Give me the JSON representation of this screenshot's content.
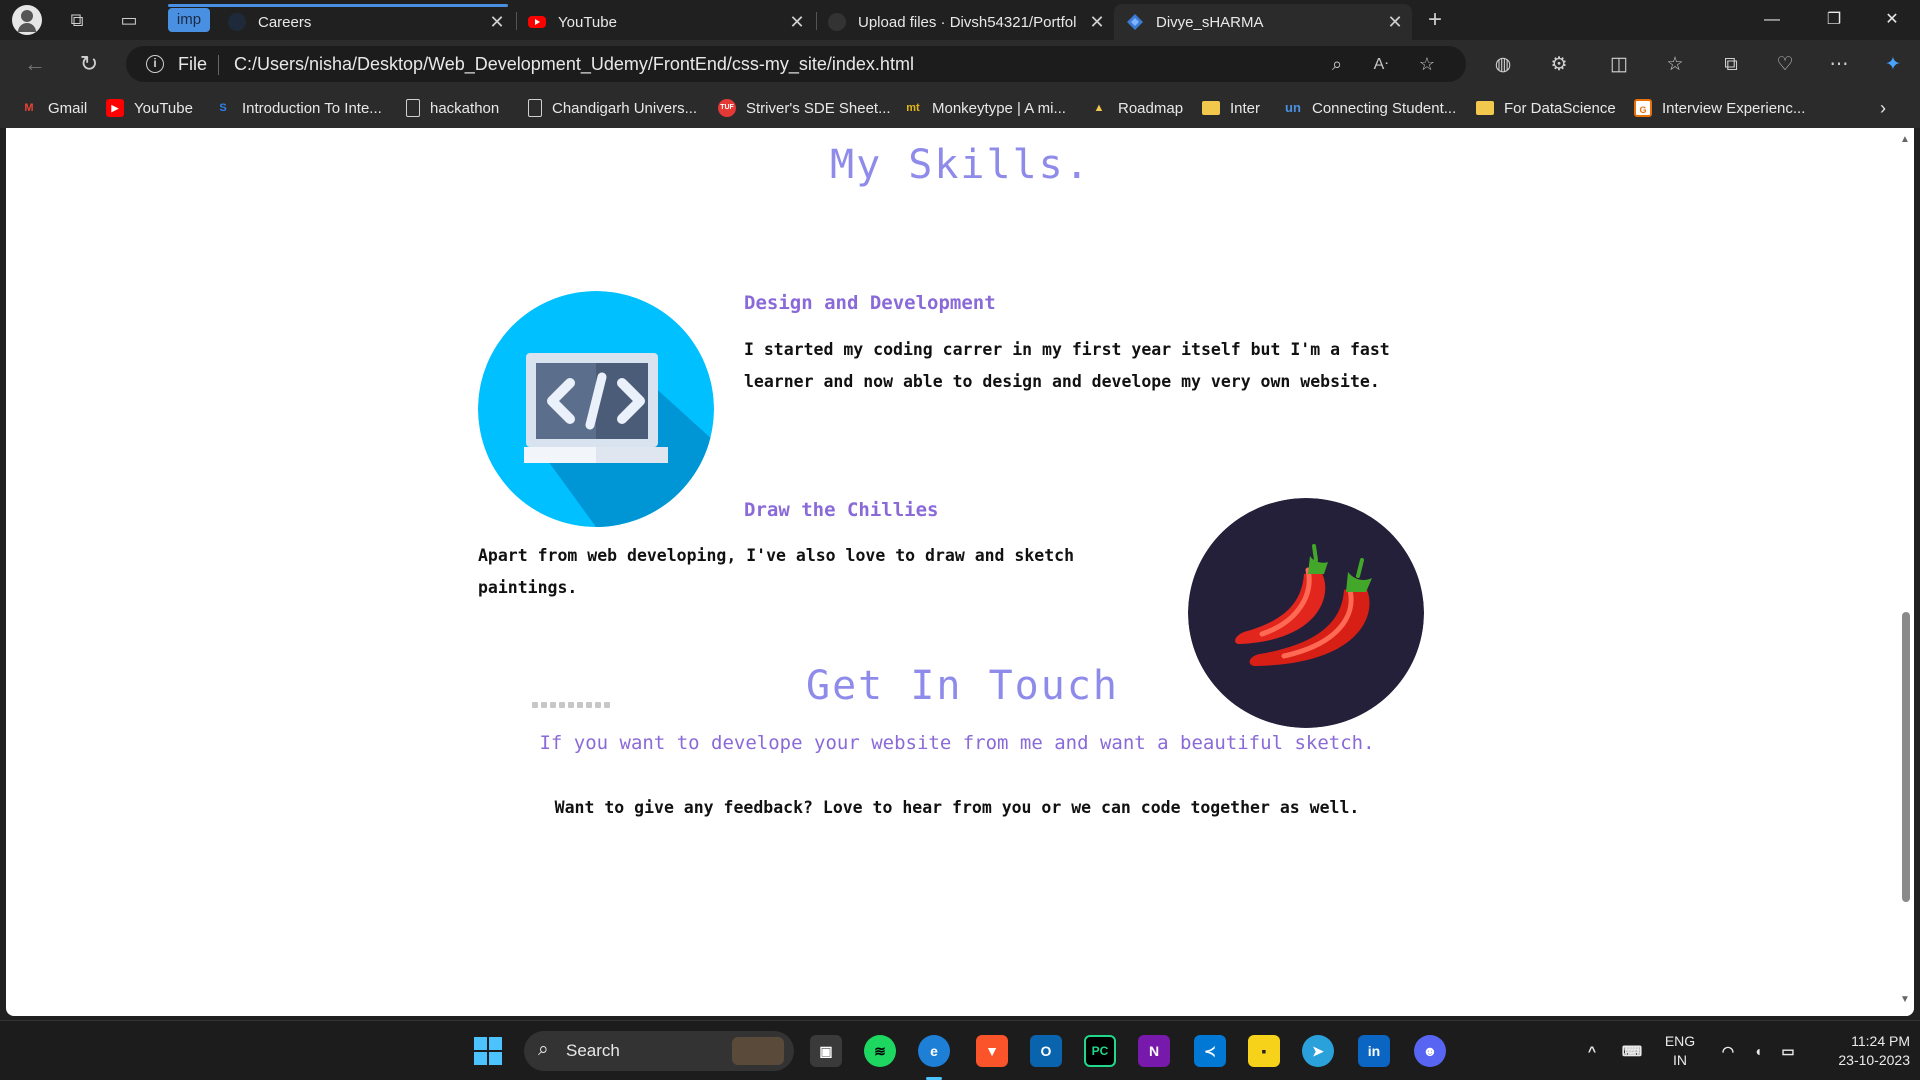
{
  "browser": {
    "tab_group_label": "imp",
    "tabs": [
      {
        "label": "Careers",
        "active": false
      },
      {
        "label": "YouTube",
        "active": false
      },
      {
        "label": "Upload files · Divsh54321/Portfol",
        "active": false
      },
      {
        "label": "Divye_sHARMA",
        "active": true
      }
    ],
    "address": {
      "scheme_label": "File",
      "url": "C:/Users/nisha/Desktop/Web_Development_Udemy/FrontEnd/css-my_site/index.html"
    },
    "bookmarks": [
      {
        "label": "Gmail",
        "icon": "gmail-icon"
      },
      {
        "label": "YouTube",
        "icon": "youtube-icon"
      },
      {
        "label": "Introduction To Inte...",
        "icon": "s-logo-icon"
      },
      {
        "label": "hackathon",
        "icon": "page-icon"
      },
      {
        "label": "Chandigarh Univers...",
        "icon": "page-icon"
      },
      {
        "label": "Striver's SDE Sheet...",
        "icon": "tuf-icon"
      },
      {
        "label": "Monkeytype | A mi...",
        "icon": "monkeytype-icon"
      },
      {
        "label": "Roadmap",
        "icon": "rocket-icon"
      },
      {
        "label": "Inter",
        "icon": "folder-icon"
      },
      {
        "label": "Connecting Student...",
        "icon": "un-icon"
      },
      {
        "label": "For DataScience",
        "icon": "folder-icon"
      },
      {
        "label": "Interview Experienc...",
        "icon": "gfg-icon"
      }
    ],
    "accent": "#4a90e2"
  },
  "page": {
    "skills_title": "My Skills.",
    "skill1": {
      "heading": "Design and Development",
      "text_line1": "I started my coding carrer in my first year itself but I'm a fast",
      "text_line2": "learner and now able to design and develope my very own website."
    },
    "skill2": {
      "heading": "Draw the Chillies",
      "text_line1": "Apart from web developing, I've also love to draw and sketch",
      "text_line2": "paintings."
    },
    "contact_title": "Get In Touch",
    "contact_sub": "If you want to develope your website from me and want a beautiful sketch.",
    "contact_text": "Want to give any feedback? Love to hear from you or we can code together as well.",
    "colors": {
      "title": "#8f8bea",
      "subhead": "#8a6ad8",
      "code_circle": "#00c0ff",
      "chilli_circle": "#24203a"
    }
  },
  "taskbar": {
    "search_label": "Search",
    "lang_line1": "ENG",
    "lang_line2": "IN",
    "time": "11:24 PM",
    "date": "23-10-2023"
  }
}
